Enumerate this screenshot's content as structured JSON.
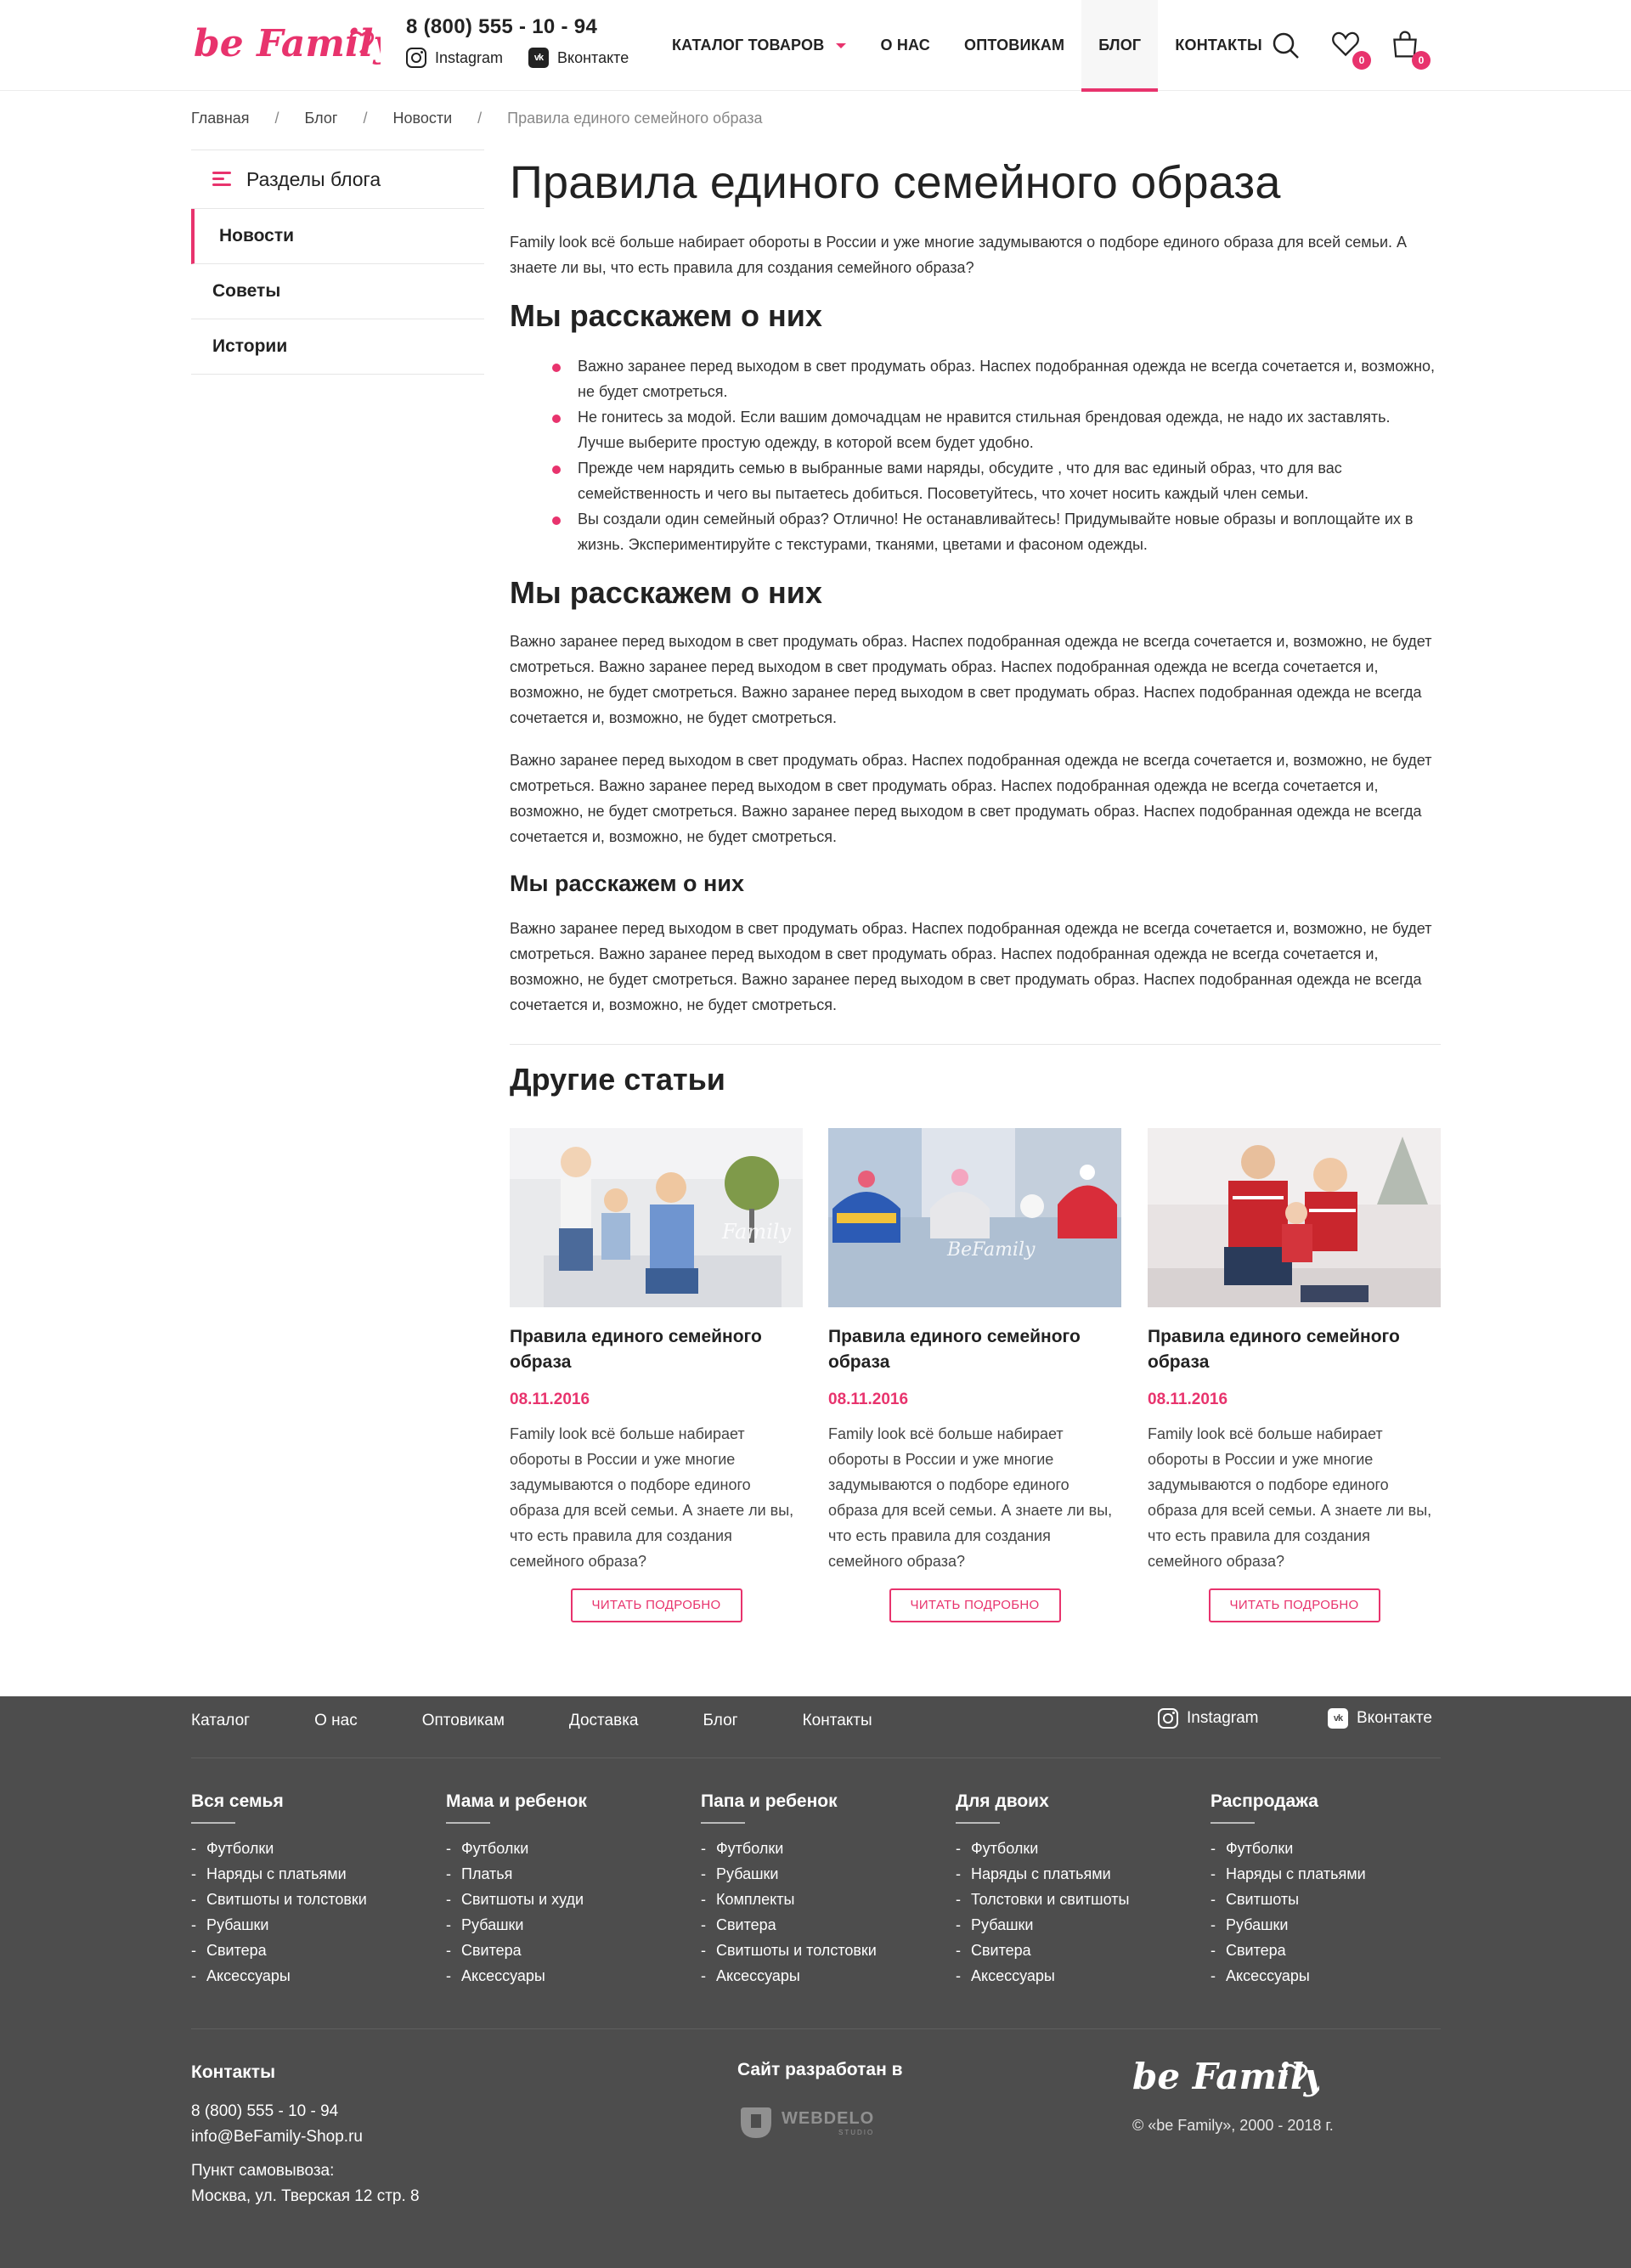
{
  "header": {
    "logo": "be Family",
    "phone": "8 (800) 555 - 10 - 94",
    "instagram": "Instagram",
    "vk": "Вконтакте",
    "nav": [
      "КАТАЛОГ ТОВАРОВ",
      "О НАС",
      "ОПТОВИКАМ",
      "БЛОГ",
      "КОНТАКТЫ"
    ],
    "active_nav": "БЛОГ",
    "wishlist_count": "0",
    "cart_count": "0",
    "icons": [
      "search-icon",
      "heart-icon",
      "bag-icon"
    ]
  },
  "breadcrumb": [
    "Главная",
    "Блог",
    "Новости",
    "Правила единого семейного образа"
  ],
  "sidebar": {
    "title": "Разделы блога",
    "items": [
      "Новости",
      "Советы",
      "Истории"
    ],
    "active": "Новости"
  },
  "article": {
    "title": "Правила единого семейного образа",
    "intro": "Family look всё больше набирает обороты в России и уже многие задумываются о подборе единого образа для всей семьи. А знаете ли вы, что есть правила для создания семейного образа?",
    "h2_1": "Мы расскажем о них",
    "bullets": [
      "Важно заранее перед выходом в свет продумать образ. Наспех подобранная одежда не всегда сочетается и, возможно, не будет смотреться.",
      "Не гонитесь за модой. Если вашим домочадцам не нравится стильная брендовая одежда, не надо их заставлять. Лучше выберите простую одежду, в которой всем будет удобно.",
      "Прежде чем нарядить семью в выбранные вами наряды, обсудите , что для вас единый образ, что для вас семейственность и чего вы пытаетесь добиться. Посоветуйтесь, что хочет носить каждый член семьи.",
      "Вы создали один семейный образ? Отлично! Не останавливайтесь! Придумывайте новые образы и воплощайте их в жизнь. Экспериментируйте с текстурами, тканями, цветами и фасоном одежды."
    ],
    "h2_2": "Мы расскажем о них",
    "para_1": "Важно заранее перед выходом в свет продумать образ. Наспех подобранная одежда не всегда сочетается и, возможно, не будет смотреться. Важно заранее перед выходом в свет продумать образ. Наспех подобранная одежда не всегда сочетается и, возможно, не будет смотреться. Важно заранее перед выходом в свет продумать образ. Наспех подобранная одежда не всегда сочетается и, возможно, не будет смотреться.",
    "para_2": "Важно заранее перед выходом в свет продумать образ. Наспех подобранная одежда не всегда сочетается и, возможно, не будет смотреться. Важно заранее перед выходом в свет продумать образ. Наспех подобранная одежда не всегда сочетается и, возможно, не будет смотреться. Важно заранее перед выходом в свет продумать образ. Наспех подобранная одежда не всегда сочетается и, возможно, не будет смотреться.",
    "h3": "Мы расскажем о них",
    "para_3": "Важно заранее перед выходом в свет продумать образ. Наспех подобранная одежда не всегда сочетается и, возможно, не будет смотреться. Важно заранее перед выходом в свет продумать образ. Наспех подобранная одежда не всегда сочетается и, возможно, не будет смотреться. Важно заранее перед выходом в свет продумать образ. Наспех подобранная одежда не всегда сочетается и, возможно, не будет смотреться."
  },
  "other_articles": {
    "title": "Другие статьи",
    "cards": [
      {
        "title": "Правила единого семейного образа",
        "date": "08.11.2016",
        "text": "Family look всё больше набирает обороты в России и уже многие задумываются о подборе единого образа для всей семьи. А знаете ли вы, что есть правила для создания семейного образа?",
        "button": "ЧИТАТЬ ПОДРОБНО"
      },
      {
        "title": "Правила единого семейного образа",
        "date": "08.11.2016",
        "text": "Family look всё больше набирает обороты в России и уже многие задумываются о подборе единого образа для всей семьи. А знаете ли вы, что есть правила для создания семейного образа?",
        "button": "ЧИТАТЬ ПОДРОБНО"
      },
      {
        "title": "Правила единого семейного образа",
        "date": "08.11.2016",
        "text": "Family look всё больше набирает обороты в России и уже многие задумываются о подборе единого образа для всей семьи. А знаете ли вы, что есть правила для создания семейного образа?",
        "button": "ЧИТАТЬ ПОДРОБНО"
      }
    ]
  },
  "footer": {
    "nav": [
      "Каталог",
      "О нас",
      "Оптовикам",
      "Доставка",
      "Блог",
      "Контакты"
    ],
    "instagram": "Instagram",
    "vk": "Вконтакте",
    "columns": [
      {
        "title": "Вся семья",
        "items": [
          "Футболки",
          "Наряды с платьями",
          "Свитшоты и толстовки",
          "Рубашки",
          "Свитера",
          "Аксессуары"
        ]
      },
      {
        "title": "Мама и ребенок",
        "items": [
          "Футболки",
          "Платья",
          "Свитшоты и худи",
          "Рубашки",
          "Свитера",
          "Аксессуары"
        ]
      },
      {
        "title": "Папа и ребенок",
        "items": [
          "Футболки",
          "Рубашки",
          "Комплекты",
          "Свитера",
          "Свитшоты и толстовки",
          "Аксессуары"
        ]
      },
      {
        "title": "Для двоих",
        "items": [
          "Футболки",
          "Наряды с платьями",
          "Толстовки и свитшоты",
          "Рубашки",
          "Свитера",
          "Аксессуары"
        ]
      },
      {
        "title": "Распродажа",
        "items": [
          "Футболки",
          "Наряды с платьями",
          "Свитшоты",
          "Рубашки",
          "Свитера",
          "Аксессуары"
        ]
      }
    ],
    "contacts_title": "Контакты",
    "phone": "8 (800) 555 - 10 - 94",
    "email": "info@BeFamily-Shop.ru",
    "pickup_label": "Пункт самовывоза:",
    "pickup_address": "Москва, ул. Тверская 12 стр. 8",
    "dev_title": "Сайт разработан в",
    "dev_logo": "WEBDELO",
    "dev_logo_sub": "STUDIO",
    "brand_logo": "be Family",
    "copyright": "© «be Family», 2000 - 2018 г."
  },
  "colors": {
    "accent": "#e8336d",
    "footer_bg": "#4d4d4d"
  }
}
